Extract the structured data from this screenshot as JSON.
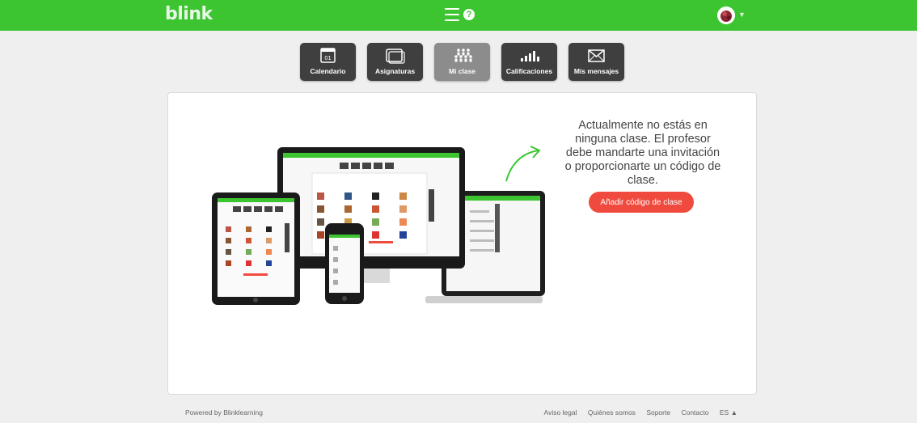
{
  "app": {
    "logo": "blink"
  },
  "nav": {
    "items": [
      {
        "label": "Calendario",
        "icon": "calendar-icon",
        "calendar_day": "01"
      },
      {
        "label": "Asignaturas",
        "icon": "subjects-icon"
      },
      {
        "label": "Mi clase",
        "icon": "class-icon",
        "active": true
      },
      {
        "label": "Calificaciones",
        "icon": "grades-icon"
      },
      {
        "label": "Mis mensajes",
        "icon": "envelope-icon"
      }
    ]
  },
  "main": {
    "message": "Actualmente no estás en ninguna clase. El profesor debe mandarte una invitación o proporcionarte un código de clase.",
    "add_code_button": "Añadir código de clase"
  },
  "footer": {
    "powered": "Powered by Blinklearning",
    "links": [
      "Aviso legal",
      "Quiénes somos",
      "Soporte",
      "Contacto"
    ],
    "language": "ES ▲"
  },
  "colors": {
    "brand_green": "#3cc531",
    "accent_red": "#ef4a3d",
    "nav_dark": "#3f3f3f",
    "nav_active": "#8c8c8c"
  }
}
